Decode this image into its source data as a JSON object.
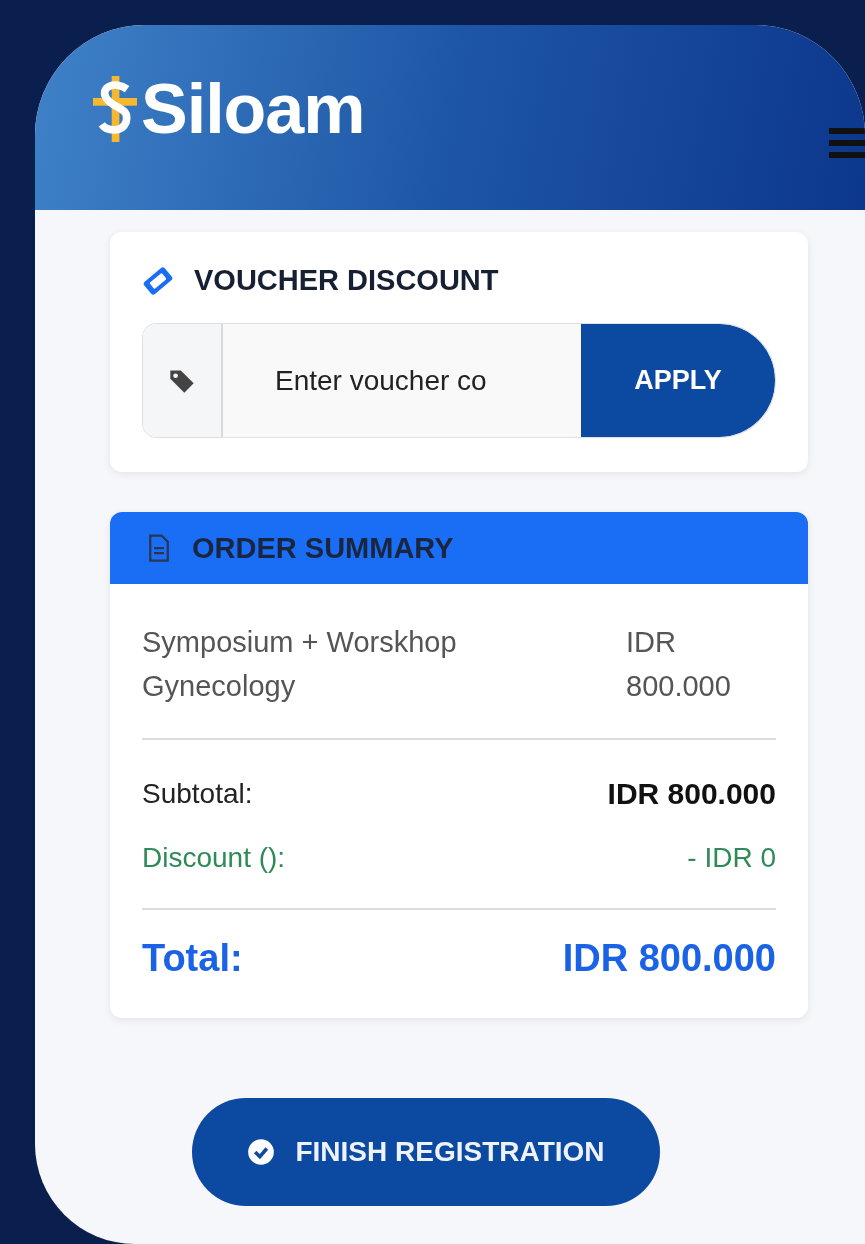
{
  "header": {
    "logo_text": "Siloam"
  },
  "voucher": {
    "title": "VOUCHER DISCOUNT",
    "placeholder": "Enter voucher co",
    "button": "APPLY"
  },
  "order_summary": {
    "title": "ORDER SUMMARY",
    "items": [
      {
        "name": "Symposium + Worskhop Gynecology",
        "price": "IDR 800.000"
      }
    ],
    "subtotal_label": "Subtotal:",
    "subtotal": "IDR 800.000",
    "discount_label": "Discount ():",
    "discount": "- IDR 0",
    "total_label": "Total:",
    "total": "IDR 800.000"
  },
  "finish_button": "FINISH REGISTRATION"
}
